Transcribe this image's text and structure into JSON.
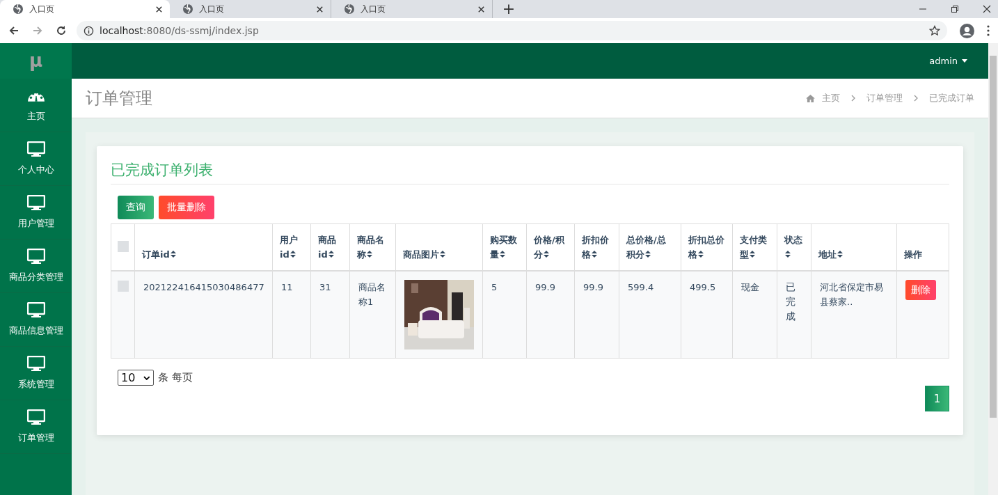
{
  "browser": {
    "tabs": [
      {
        "title": "入口页",
        "selected": true
      },
      {
        "title": "入口页",
        "selected": false
      },
      {
        "title": "入口页",
        "selected": false
      }
    ],
    "new_tab": "+",
    "url_host": "localhost",
    "url_rest": ":8080/ds-ssmj/index.jsp"
  },
  "sidebar": {
    "logo": "μ",
    "items": [
      {
        "label": "主页",
        "kind": "dashboard"
      },
      {
        "label": "个人中心",
        "kind": "monitor"
      },
      {
        "label": "用户管理",
        "kind": "monitor"
      },
      {
        "label": "商品分类管理",
        "kind": "monitor"
      },
      {
        "label": "商品信息管理",
        "kind": "monitor"
      },
      {
        "label": "系统管理",
        "kind": "monitor"
      },
      {
        "label": "订单管理",
        "kind": "monitor"
      }
    ]
  },
  "header": {
    "user": "admin"
  },
  "page_title": "订单管理",
  "breadcrumb": [
    "主页",
    "订单管理",
    "已完成订单"
  ],
  "card": {
    "title": "已完成订单列表",
    "buttons": [
      {
        "label": "查询",
        "kind": "primary"
      },
      {
        "label": "批量删除",
        "kind": "danger"
      }
    ]
  },
  "table": {
    "select_all": {
      "checked": false
    },
    "columns": [
      {
        "label": "订单id",
        "sortable": true
      },
      {
        "label": "用户id",
        "sortable": true
      },
      {
        "label": "商品id",
        "sortable": true
      },
      {
        "label": "商品名称",
        "sortable": true
      },
      {
        "label": "商品图片",
        "sortable": true
      },
      {
        "label": "购买数量",
        "sortable": true
      },
      {
        "label": "价格/积分",
        "sortable": true
      },
      {
        "label": "折扣价格",
        "sortable": true
      },
      {
        "label": "总价格/总积分",
        "sortable": true
      },
      {
        "label": "折扣总价格",
        "sortable": true
      },
      {
        "label": "支付类型",
        "sortable": true
      },
      {
        "label": "状态",
        "sortable": true
      },
      {
        "label": "地址",
        "sortable": true
      },
      {
        "label": "操作",
        "sortable": false
      }
    ],
    "rows": [
      {
        "checked": false,
        "cells": [
          "202122416415030486477",
          "11",
          "31",
          "商品名称1",
          {
            "kind": "picture"
          },
          "5",
          "99.9",
          "99.9",
          "599.4",
          "499.5",
          "现金",
          "已完成",
          "河北省保定市易县蔡家..",
          {
            "kind": "button",
            "label": "删除"
          }
        ]
      }
    ]
  },
  "pager": {
    "page_size": "10",
    "per_page_text": "条 每页",
    "pages": [
      {
        "label": "1",
        "selected": true
      }
    ]
  }
}
